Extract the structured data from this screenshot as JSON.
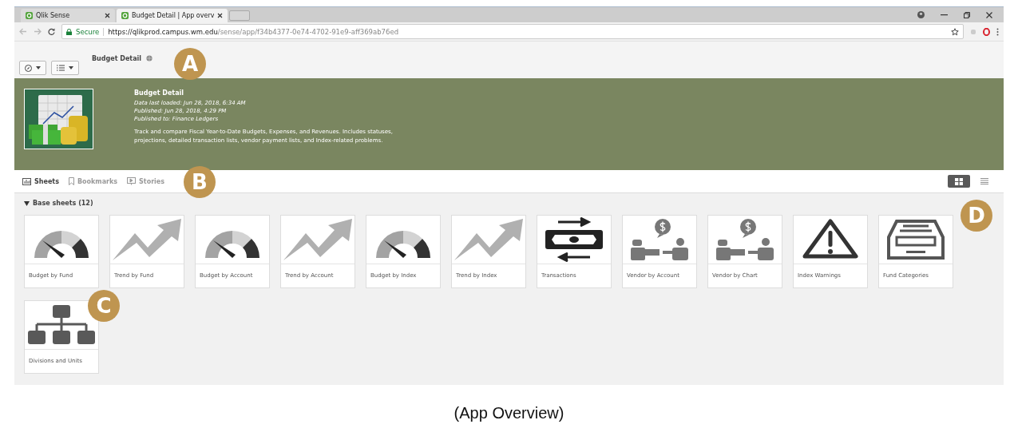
{
  "browser": {
    "tabs": [
      {
        "title": "Qlik Sense",
        "selected": false
      },
      {
        "title": "Budget Detail | App overv",
        "selected": true
      }
    ],
    "url": {
      "secure_label": "Secure",
      "host": "https://qlikprod.campus.wm.edu",
      "path": "/sense/app/f34b4377-0e74-4702-91e9-aff369ab76ed"
    }
  },
  "toolbar": {
    "app_title": "Budget Detail"
  },
  "app": {
    "title": "Budget Detail",
    "meta": [
      "Data last loaded: Jun 28, 2018, 6:34 AM",
      "Published: Jun 28, 2018, 4:29 PM",
      "Published to: Finance Ledgers"
    ],
    "description": "Track and compare Fiscal Year-to-Date Budgets, Expenses, and Revenues. Includes statuses, projections, detailed transaction lists, vendor payment lists, and Index-related problems."
  },
  "section_tabs": [
    {
      "label": "Sheets",
      "kind": "sheets",
      "selected": true
    },
    {
      "label": "Bookmarks",
      "kind": "bookmarks",
      "selected": false
    },
    {
      "label": "Stories",
      "kind": "stories",
      "selected": false
    }
  ],
  "view_toggle": [
    {
      "kind": "grid",
      "selected": true
    },
    {
      "kind": "list",
      "selected": false
    }
  ],
  "group": {
    "title": "Base sheets (12)",
    "expanded": true
  },
  "sheets": [
    {
      "title": "Budget by Fund",
      "kind": "gauge"
    },
    {
      "title": "Trend by Fund",
      "kind": "trend"
    },
    {
      "title": "Budget by Account",
      "kind": "gauge"
    },
    {
      "title": "Trend by Account",
      "kind": "trend"
    },
    {
      "title": "Budget by Index",
      "kind": "gauge"
    },
    {
      "title": "Trend by Index",
      "kind": "trend"
    },
    {
      "title": "Transactions",
      "kind": "money"
    },
    {
      "title": "Vendor by Account",
      "kind": "vendor"
    },
    {
      "title": "Vendor by Chart",
      "kind": "vendor"
    },
    {
      "title": "Index Warnings",
      "kind": "warning"
    },
    {
      "title": "Fund Categories",
      "kind": "drawer"
    },
    {
      "title": "Divisions and Units",
      "kind": "org"
    }
  ],
  "annotations": [
    {
      "letter": "A"
    },
    {
      "letter": "B"
    },
    {
      "letter": "C"
    },
    {
      "letter": "D"
    }
  ],
  "caption": "(App Overview)"
}
